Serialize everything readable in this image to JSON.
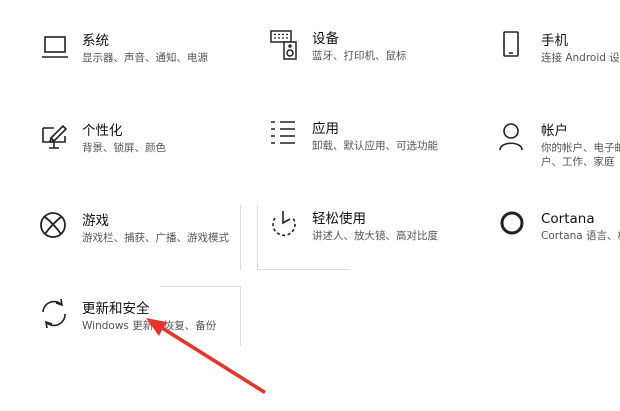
{
  "tiles": [
    {
      "id": "system",
      "title": "系统",
      "desc": "显示器、声音、通知、电源",
      "icon": "laptop-icon"
    },
    {
      "id": "devices",
      "title": "设备",
      "desc": "蓝牙、打印机、鼠标",
      "icon": "keyboard-speaker-icon"
    },
    {
      "id": "phone",
      "title": "手机",
      "desc": "连接 Android 设",
      "icon": "phone-icon"
    },
    {
      "id": "personalization",
      "title": "个性化",
      "desc": "背景、锁屏、颜色",
      "icon": "paint-icon"
    },
    {
      "id": "apps",
      "title": "应用",
      "desc": "卸载、默认应用、可选功能",
      "icon": "apps-list-icon"
    },
    {
      "id": "accounts",
      "title": "帐户",
      "desc1": "你的帐户、电子邮",
      "desc2": "户、工作、家庭",
      "icon": "person-icon"
    },
    {
      "id": "gaming",
      "title": "游戏",
      "desc": "游戏栏、捕获、广播、游戏模式",
      "icon": "xbox-icon"
    },
    {
      "id": "ease",
      "title": "轻松使用",
      "desc": "讲述人、放大镜、高对比度",
      "icon": "ease-of-access-icon"
    },
    {
      "id": "cortana",
      "title": "Cortana",
      "desc": "Cortana 语言、权",
      "icon": "cortana-icon"
    },
    {
      "id": "update",
      "title": "更新和安全",
      "desc": "Windows 更新、恢复、备份",
      "icon": "sync-icon"
    }
  ],
  "colors": {
    "annotation_arrow": "#e8332a",
    "text_secondary": "#555555"
  }
}
